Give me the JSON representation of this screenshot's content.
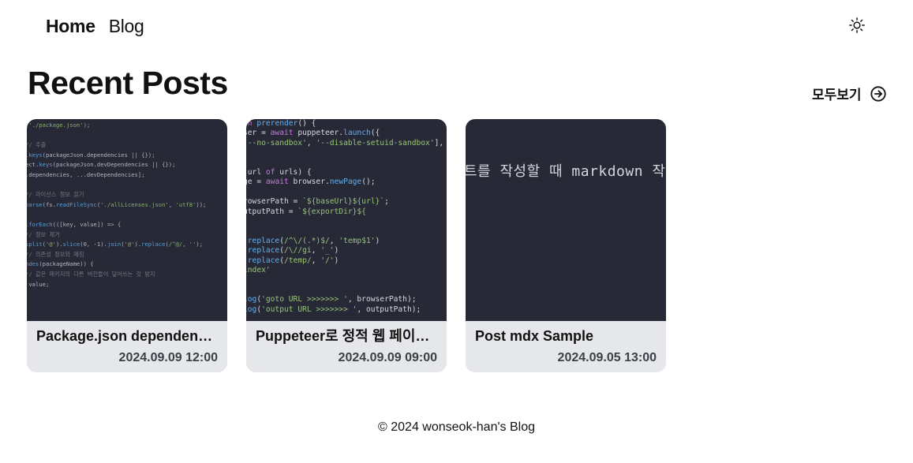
{
  "nav": {
    "home_label": "Home",
    "blog_label": "Blog"
  },
  "theme_toggle_icon": "sun-icon",
  "section": {
    "title": "Recent Posts",
    "view_all_label": "모두보기",
    "view_all_icon": "arrow-right-circle-icon"
  },
  "posts": [
    {
      "title": "Package.json dependencies",
      "date": "2024.09.09 12:00"
    },
    {
      "title": "Puppeteer로 정적 웹 페이지 만들기",
      "date": "2024.09.09 09:00"
    },
    {
      "title": "Post mdx Sample",
      "date": "2024.09.05 13:00"
    }
  ],
  "footer": {
    "text": "© 2024 wonseok-han's Blog"
  },
  "colors": {
    "card_background": "#e6e7ea",
    "thumbnail_background": "#272a36",
    "text": "#111111"
  }
}
